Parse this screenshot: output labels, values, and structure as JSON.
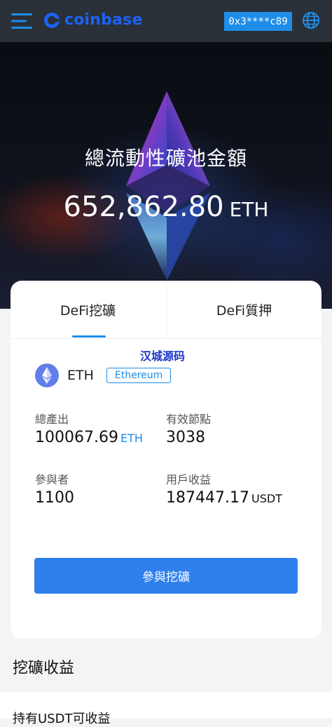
{
  "header": {
    "logo_text": "coinbase",
    "wallet_address": "0x3****c89",
    "menu_icon": "hamburger-menu-icon",
    "language_icon": "globe-icon",
    "bg_color": "#2a3038",
    "brand_color": "#1c62f5"
  },
  "hero": {
    "title": "總流動性礦池金額",
    "amount": "652,862.80",
    "unit": "ETH"
  },
  "card": {
    "tabs": [
      {
        "label": "DeFi挖礦",
        "active": true
      },
      {
        "label": "DeFi質押",
        "active": false
      }
    ],
    "watermark": "汉城源码",
    "coin": {
      "name": "ETH",
      "network": "Ethereum",
      "icon": "ethereum-icon"
    },
    "stats": {
      "total_output_label": "總產出",
      "total_output_value": "100067.69",
      "total_output_unit": "ETH",
      "valid_nodes_label": "有效節點",
      "valid_nodes_value": "3038",
      "participants_label": "參與者",
      "participants_value": "1100",
      "user_earnings_label": "用戶收益",
      "user_earnings_value": "187447.17",
      "user_earnings_unit": "USDT"
    },
    "join_button": "參與挖礦",
    "accent_color": "#1e8de8"
  },
  "mining_income": {
    "title": "挖礦收益",
    "subtitle": "持有USDT可收益"
  }
}
